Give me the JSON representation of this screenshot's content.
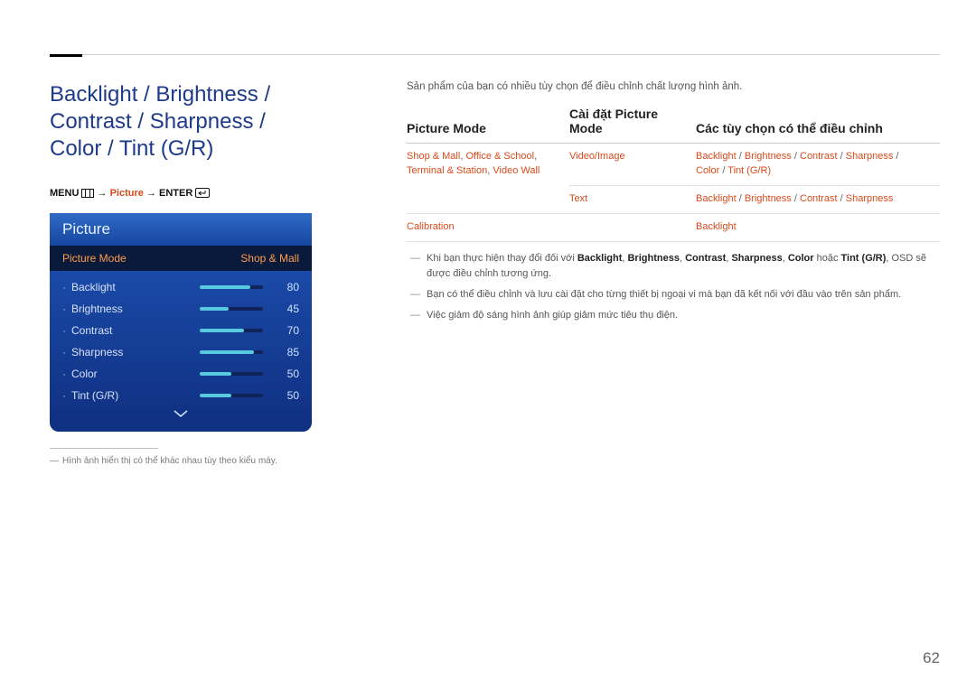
{
  "heading": "Backlight / Brightness / Contrast / Sharpness / Color / Tint (G/R)",
  "nav": {
    "menu": "MENU",
    "arrow": "→",
    "picture": "Picture",
    "enter": "ENTER"
  },
  "osd": {
    "title": "Picture",
    "selected_label": "Picture Mode",
    "selected_value": "Shop & Mall",
    "rows": [
      {
        "name": "Backlight",
        "value": 80
      },
      {
        "name": "Brightness",
        "value": 45
      },
      {
        "name": "Contrast",
        "value": 70
      },
      {
        "name": "Sharpness",
        "value": 85
      },
      {
        "name": "Color",
        "value": 50
      },
      {
        "name": "Tint (G/R)",
        "value": 50
      }
    ],
    "footnote": "Hình ảnh hiển thị có thể khác nhau tùy theo kiểu máy."
  },
  "intro": "Sản phẩm của bạn có nhiều tùy chọn để điều chỉnh chất lượng hình ảnh.",
  "table": {
    "headers": [
      "Picture Mode",
      "Cài đặt Picture Mode",
      "Các tùy chọn có thể điều chỉnh"
    ],
    "rows": [
      {
        "mode": "Shop & Mall, Office & School, Terminal & Station, Video Wall",
        "setting": "Video/Image",
        "options_parts": [
          "Backlight",
          "Brightness",
          "Contrast",
          "Sharpness",
          "Color",
          "Tint (G/R)"
        ]
      },
      {
        "mode": "",
        "setting": "Text",
        "options_parts": [
          "Backlight",
          "Brightness",
          "Contrast",
          "Sharpness"
        ]
      },
      {
        "mode": "Calibration",
        "setting": "",
        "options_parts": [
          "Backlight"
        ]
      }
    ]
  },
  "notes": {
    "n1_prefix": "Khi bạn thực hiện thay đổi đối với ",
    "n1_terms": [
      "Backlight",
      "Brightness",
      "Contrast",
      "Sharpness",
      "Color"
    ],
    "n1_or": " hoặc ",
    "n1_last": "Tint (G/R)",
    "n1_suffix": ", OSD sẽ được điều chỉnh tương ứng.",
    "n2": "Bạn có thể điều chỉnh và lưu cài đặt cho từng thiết bị ngoại vi mà bạn đã kết nối với đầu vào trên sản phẩm.",
    "n3": "Việc giảm độ sáng hình ảnh giúp giảm mức tiêu thụ điện."
  },
  "page_number": "62"
}
